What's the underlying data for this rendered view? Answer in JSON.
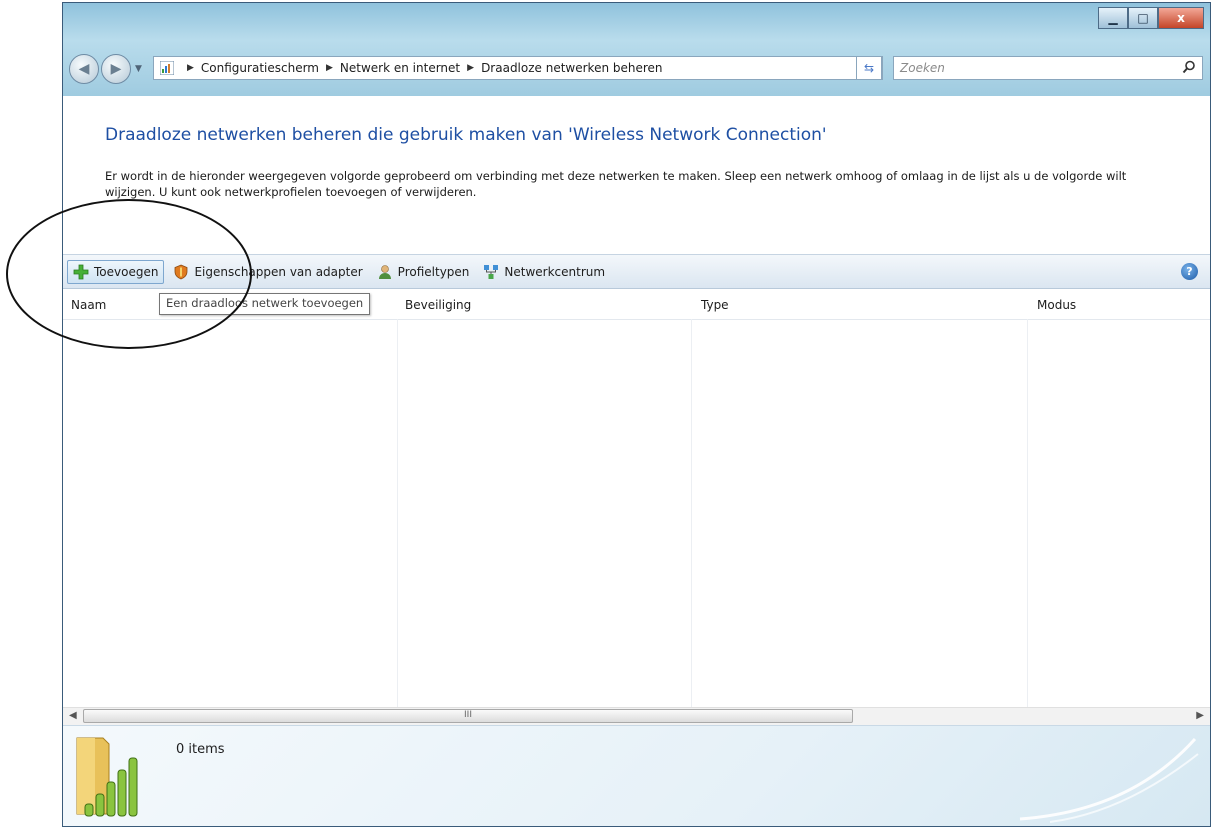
{
  "window": {
    "title_buttons": [
      "minimize",
      "maximize",
      "close"
    ],
    "close_glyph": "x"
  },
  "address_bar": {
    "breadcrumbs": [
      "Configuratiescherm",
      "Netwerk en internet",
      "Draadloze netwerken beheren"
    ],
    "search_placeholder": "Zoeken"
  },
  "content": {
    "heading": "Draadloze netwerken beheren die gebruik maken van 'Wireless Network Connection'",
    "description": "Er wordt in de hieronder weergegeven volgorde geprobeerd om verbinding met deze netwerken te maken. Sleep een netwerk omhoog of omlaag in de lijst als u de volgorde wilt wijzigen. U kunt ook netwerkprofielen toevoegen of verwijderen."
  },
  "toolbar": {
    "items": [
      {
        "label": "Toevoegen",
        "icon": "add-icon"
      },
      {
        "label": "Eigenschappen van adapter",
        "icon": "shield-icon"
      },
      {
        "label": "Profieltypen",
        "icon": "user-icon"
      },
      {
        "label": "Netwerkcentrum",
        "icon": "network-icon"
      }
    ],
    "tooltip": "Een draadloos netwerk toevoegen"
  },
  "list": {
    "columns": [
      "Naam",
      "Beveiliging",
      "Type",
      "Modus"
    ],
    "rows": []
  },
  "scrollbar": {
    "grip": "III"
  },
  "details": {
    "count": "0 items"
  },
  "colors": {
    "heading": "#1e4fa3",
    "chrome": "#9fcbe0",
    "close_button": "#c44528"
  }
}
